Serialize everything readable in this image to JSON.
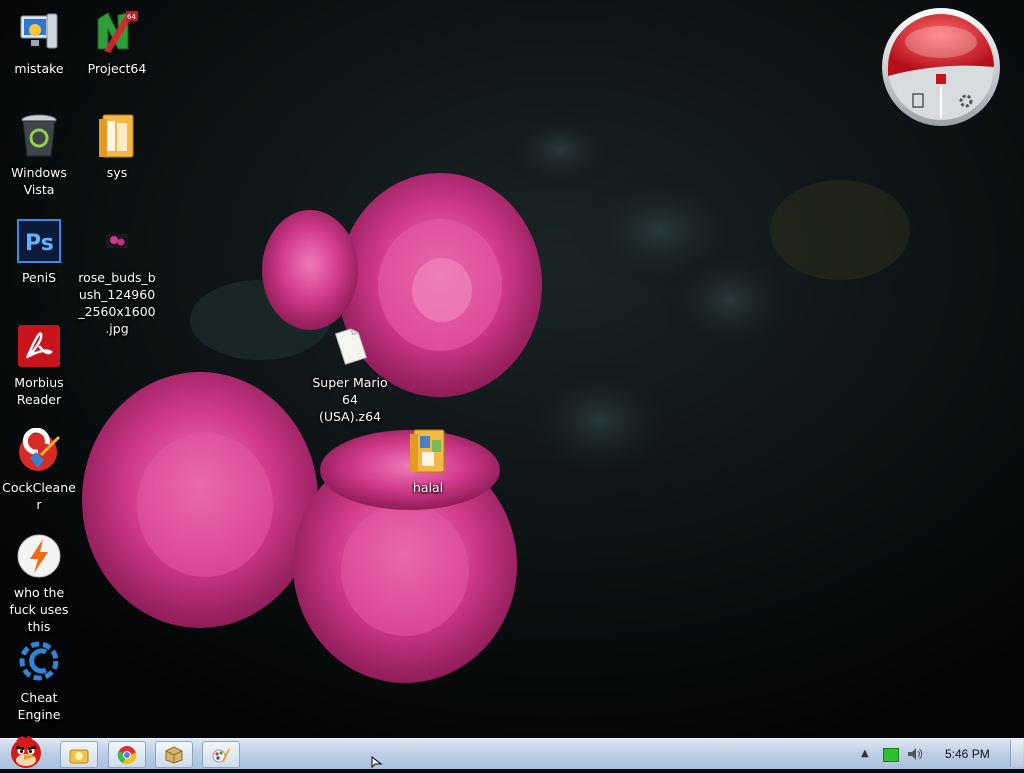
{
  "desktop_icons": [
    {
      "label": "mistake",
      "icon": "computer-settings-icon"
    },
    {
      "label": "Project64",
      "icon": "project64-icon"
    },
    {
      "label": "Windows Vista",
      "icon": "recycle-bin-icon"
    },
    {
      "label": "sys",
      "icon": "folder-icon"
    },
    {
      "label": "PeniS",
      "icon": "photoshop-icon"
    },
    {
      "label": "rose_buds_bush_124960_2560x1600.jpg",
      "icon": "image-file-icon"
    },
    {
      "label": "Morbius Reader",
      "icon": "pdf-reader-icon"
    },
    {
      "label": "Super Mario 64 (USA).z64",
      "icon": "blank-file-icon"
    },
    {
      "label": "CockCleaner",
      "icon": "cleaner-icon"
    },
    {
      "label": "halal",
      "icon": "folder-icon"
    },
    {
      "label": "who the fuck uses this",
      "icon": "winamp-icon"
    },
    {
      "label": "Cheat Engine",
      "icon": "cheat-engine-icon"
    }
  ],
  "gadget": {
    "icon": "kaspersky-gadget-icon"
  },
  "taskbar": {
    "start_icon": "angry-bird-start-icon",
    "pinned": [
      "explorer-icon",
      "chrome-icon",
      "package-icon",
      "paint-icon"
    ],
    "tray_icons": [
      "show-hidden-icons-icon",
      "network-icon",
      "volume-icon"
    ],
    "clock": "5:46 PM"
  },
  "colors": {
    "rose": "#d13a8a",
    "taskbar": "#bfd0e6"
  }
}
